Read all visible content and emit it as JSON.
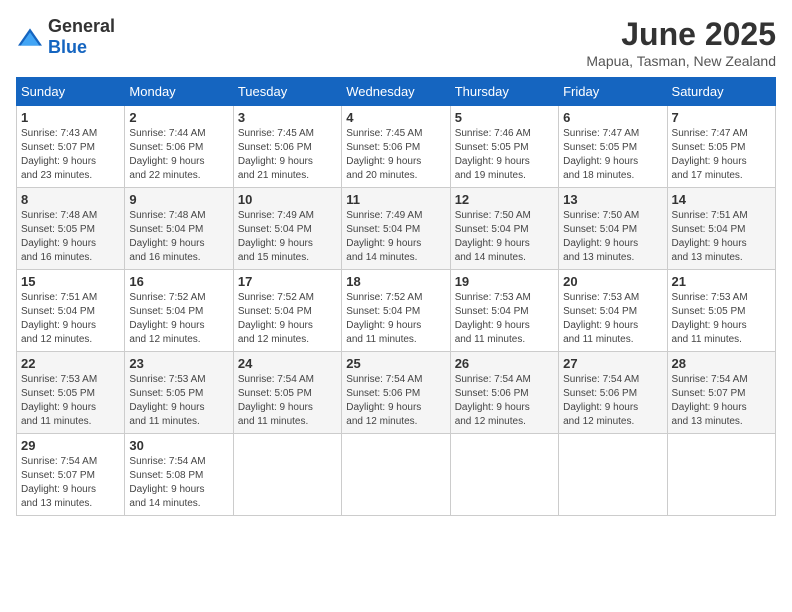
{
  "header": {
    "logo_general": "General",
    "logo_blue": "Blue",
    "month_title": "June 2025",
    "location": "Mapua, Tasman, New Zealand"
  },
  "weekdays": [
    "Sunday",
    "Monday",
    "Tuesday",
    "Wednesday",
    "Thursday",
    "Friday",
    "Saturday"
  ],
  "weeks": [
    [
      {
        "day": "1",
        "info": "Sunrise: 7:43 AM\nSunset: 5:07 PM\nDaylight: 9 hours\nand 23 minutes."
      },
      {
        "day": "2",
        "info": "Sunrise: 7:44 AM\nSunset: 5:06 PM\nDaylight: 9 hours\nand 22 minutes."
      },
      {
        "day": "3",
        "info": "Sunrise: 7:45 AM\nSunset: 5:06 PM\nDaylight: 9 hours\nand 21 minutes."
      },
      {
        "day": "4",
        "info": "Sunrise: 7:45 AM\nSunset: 5:06 PM\nDaylight: 9 hours\nand 20 minutes."
      },
      {
        "day": "5",
        "info": "Sunrise: 7:46 AM\nSunset: 5:05 PM\nDaylight: 9 hours\nand 19 minutes."
      },
      {
        "day": "6",
        "info": "Sunrise: 7:47 AM\nSunset: 5:05 PM\nDaylight: 9 hours\nand 18 minutes."
      },
      {
        "day": "7",
        "info": "Sunrise: 7:47 AM\nSunset: 5:05 PM\nDaylight: 9 hours\nand 17 minutes."
      }
    ],
    [
      {
        "day": "8",
        "info": "Sunrise: 7:48 AM\nSunset: 5:05 PM\nDaylight: 9 hours\nand 16 minutes."
      },
      {
        "day": "9",
        "info": "Sunrise: 7:48 AM\nSunset: 5:04 PM\nDaylight: 9 hours\nand 16 minutes."
      },
      {
        "day": "10",
        "info": "Sunrise: 7:49 AM\nSunset: 5:04 PM\nDaylight: 9 hours\nand 15 minutes."
      },
      {
        "day": "11",
        "info": "Sunrise: 7:49 AM\nSunset: 5:04 PM\nDaylight: 9 hours\nand 14 minutes."
      },
      {
        "day": "12",
        "info": "Sunrise: 7:50 AM\nSunset: 5:04 PM\nDaylight: 9 hours\nand 14 minutes."
      },
      {
        "day": "13",
        "info": "Sunrise: 7:50 AM\nSunset: 5:04 PM\nDaylight: 9 hours\nand 13 minutes."
      },
      {
        "day": "14",
        "info": "Sunrise: 7:51 AM\nSunset: 5:04 PM\nDaylight: 9 hours\nand 13 minutes."
      }
    ],
    [
      {
        "day": "15",
        "info": "Sunrise: 7:51 AM\nSunset: 5:04 PM\nDaylight: 9 hours\nand 12 minutes."
      },
      {
        "day": "16",
        "info": "Sunrise: 7:52 AM\nSunset: 5:04 PM\nDaylight: 9 hours\nand 12 minutes."
      },
      {
        "day": "17",
        "info": "Sunrise: 7:52 AM\nSunset: 5:04 PM\nDaylight: 9 hours\nand 12 minutes."
      },
      {
        "day": "18",
        "info": "Sunrise: 7:52 AM\nSunset: 5:04 PM\nDaylight: 9 hours\nand 11 minutes."
      },
      {
        "day": "19",
        "info": "Sunrise: 7:53 AM\nSunset: 5:04 PM\nDaylight: 9 hours\nand 11 minutes."
      },
      {
        "day": "20",
        "info": "Sunrise: 7:53 AM\nSunset: 5:04 PM\nDaylight: 9 hours\nand 11 minutes."
      },
      {
        "day": "21",
        "info": "Sunrise: 7:53 AM\nSunset: 5:05 PM\nDaylight: 9 hours\nand 11 minutes."
      }
    ],
    [
      {
        "day": "22",
        "info": "Sunrise: 7:53 AM\nSunset: 5:05 PM\nDaylight: 9 hours\nand 11 minutes."
      },
      {
        "day": "23",
        "info": "Sunrise: 7:53 AM\nSunset: 5:05 PM\nDaylight: 9 hours\nand 11 minutes."
      },
      {
        "day": "24",
        "info": "Sunrise: 7:54 AM\nSunset: 5:05 PM\nDaylight: 9 hours\nand 11 minutes."
      },
      {
        "day": "25",
        "info": "Sunrise: 7:54 AM\nSunset: 5:06 PM\nDaylight: 9 hours\nand 12 minutes."
      },
      {
        "day": "26",
        "info": "Sunrise: 7:54 AM\nSunset: 5:06 PM\nDaylight: 9 hours\nand 12 minutes."
      },
      {
        "day": "27",
        "info": "Sunrise: 7:54 AM\nSunset: 5:06 PM\nDaylight: 9 hours\nand 12 minutes."
      },
      {
        "day": "28",
        "info": "Sunrise: 7:54 AM\nSunset: 5:07 PM\nDaylight: 9 hours\nand 13 minutes."
      }
    ],
    [
      {
        "day": "29",
        "info": "Sunrise: 7:54 AM\nSunset: 5:07 PM\nDaylight: 9 hours\nand 13 minutes."
      },
      {
        "day": "30",
        "info": "Sunrise: 7:54 AM\nSunset: 5:08 PM\nDaylight: 9 hours\nand 14 minutes."
      },
      null,
      null,
      null,
      null,
      null
    ]
  ]
}
